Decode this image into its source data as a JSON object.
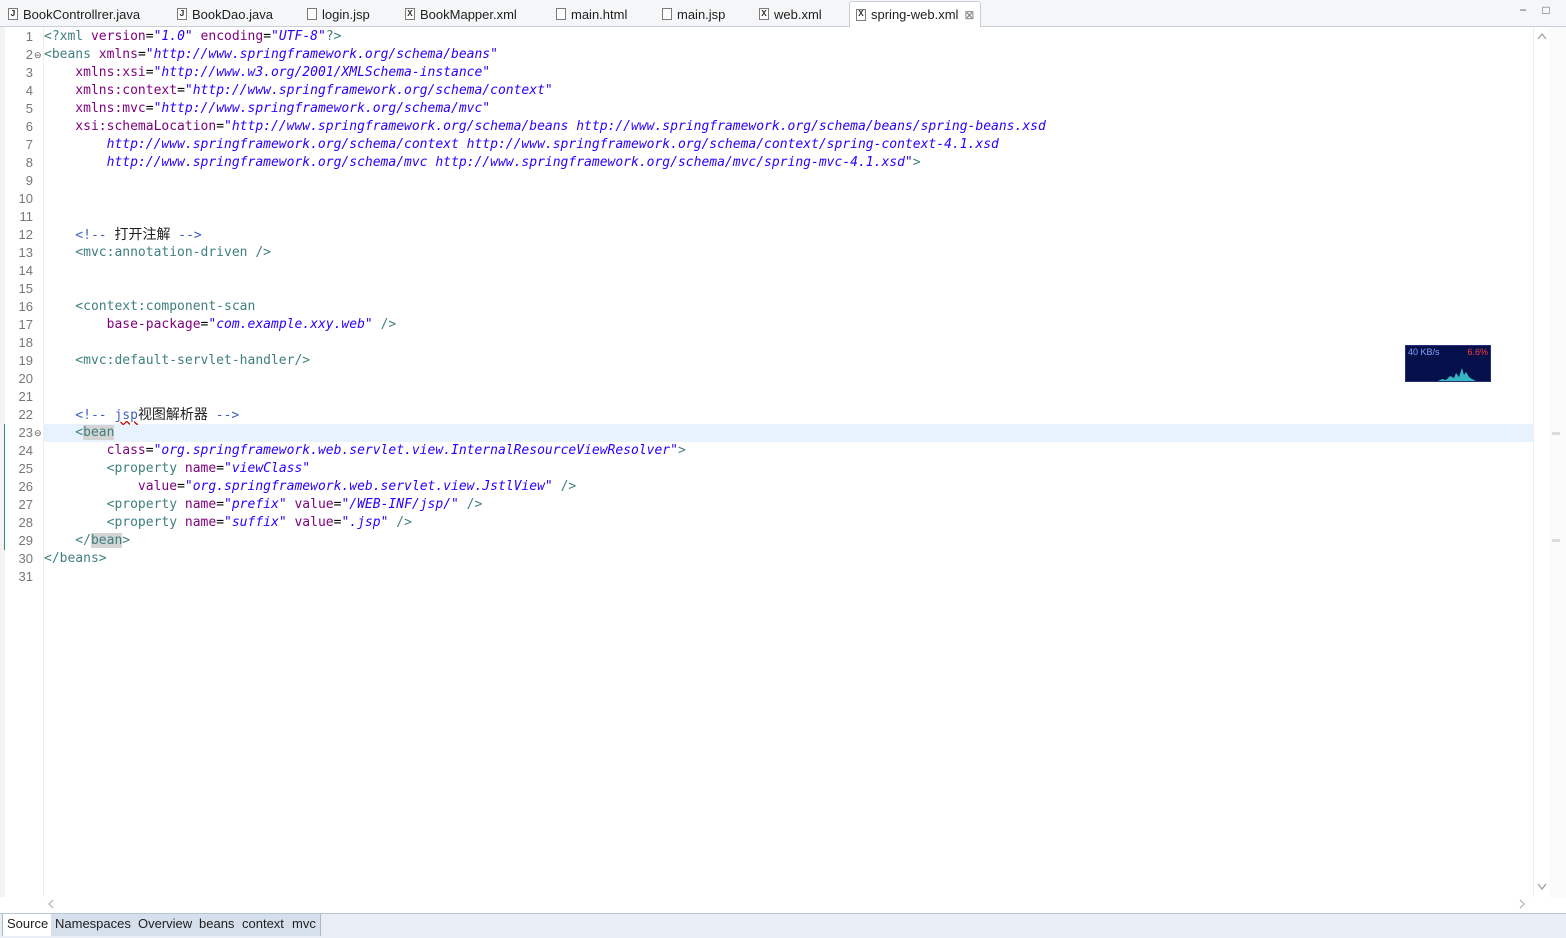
{
  "tabs": [
    {
      "label": "BookControllrer.java",
      "icon": "java-file-icon",
      "glyph": "J"
    },
    {
      "label": "BookDao.java",
      "icon": "java-file-icon",
      "glyph": "J"
    },
    {
      "label": "login.jsp",
      "icon": "jsp-file-icon",
      "glyph": ""
    },
    {
      "label": "BookMapper.xml",
      "icon": "xml-file-icon",
      "glyph": "X"
    },
    {
      "label": "main.html",
      "icon": "html-file-icon",
      "glyph": ""
    },
    {
      "label": "main.jsp",
      "icon": "jsp-file-icon",
      "glyph": ""
    },
    {
      "label": "web.xml",
      "icon": "xml-file-icon",
      "glyph": "X"
    },
    {
      "label": "spring-web.xml",
      "icon": "xml-file-icon",
      "glyph": "X",
      "active": true
    }
  ],
  "active_tab_close": "⊠",
  "window_controls": {
    "minimize": "−",
    "maximize": "□"
  },
  "line_numbers": [
    "1",
    "2",
    "3",
    "4",
    "5",
    "6",
    "7",
    "8",
    "9",
    "10",
    "11",
    "12",
    "13",
    "14",
    "15",
    "16",
    "17",
    "18",
    "19",
    "20",
    "21",
    "22",
    "23",
    "24",
    "25",
    "26",
    "27",
    "28",
    "29",
    "30",
    "31"
  ],
  "fold_marker": "⊖",
  "code": {
    "l1": {
      "a": "<?xml",
      "b": " version",
      "c": "=",
      "d": "\"1.0\"",
      "e": " encoding",
      "f": "=",
      "g": "\"UTF-8\"",
      "h": "?>"
    },
    "l2": {
      "a": "<beans",
      "b": " xmlns",
      "c": "=",
      "d": "\"http://www.springframework.org/schema/beans\""
    },
    "l3": {
      "a": "    xmlns:xsi",
      "b": "=",
      "c": "\"http://www.w3.org/2001/XMLSchema-instance\""
    },
    "l4": {
      "a": "    xmlns:context",
      "b": "=",
      "c": "\"http://www.springframework.org/schema/context\""
    },
    "l5": {
      "a": "    xmlns:mvc",
      "b": "=",
      "c": "\"http://www.springframework.org/schema/mvc\""
    },
    "l6": {
      "a": "    xsi:schemaLocation",
      "b": "=",
      "c": "\"http://www.springframework.org/schema/beans http://www.springframework.org/schema/beans/spring-beans.xsd"
    },
    "l7": {
      "a": "        http://www.springframework.org/schema/context http://www.springframework.org/schema/context/spring-context-4.1.xsd"
    },
    "l8": {
      "a": "        http://www.springframework.org/schema/mvc http://www.springframework.org/schema/mvc/spring-mvc-4.1.xsd\"",
      "b": ">"
    },
    "l12": {
      "a": "    <!-- ",
      "b": "打开注解",
      "c": " -->"
    },
    "l13": {
      "a": "    <mvc:annotation-driven />"
    },
    "l16": {
      "a": "    <context:component-scan"
    },
    "l17": {
      "a": "        base-package",
      "b": "=",
      "c": "\"com.example.xxy.web\"",
      "d": " />"
    },
    "l19": {
      "a": "    <mvc:default-servlet-handler/>"
    },
    "l22": {
      "a": "    <!-- ",
      "b": "jsp",
      "c": "视图解析器",
      "d": " -->"
    },
    "l23": {
      "a": "    <",
      "b": "bean"
    },
    "l24": {
      "a": "        class",
      "b": "=",
      "c": "\"org.springframework.web.servlet.view.InternalResourceViewResolver\"",
      "d": ">"
    },
    "l25": {
      "a": "        <property",
      "b": " name",
      "c": "=",
      "d": "\"viewClass\""
    },
    "l26": {
      "a": "            value",
      "b": "=",
      "c": "\"org.springframework.web.servlet.view.JstlView\"",
      "d": " />"
    },
    "l27": {
      "a": "        <property",
      "b": " name",
      "c": "=",
      "d": "\"prefix\"",
      "e": " value",
      "f": "=",
      "g": "\"/WEB-INF/jsp/\"",
      "h": " />"
    },
    "l28": {
      "a": "        <property",
      "b": " name",
      "c": "=",
      "d": "\"suffix\"",
      "e": " value",
      "f": "=",
      "g": "\".jsp\"",
      "h": " />"
    },
    "l29": {
      "a": "    </",
      "b": "bean",
      "c": ">"
    },
    "l30": {
      "a": "</beans>"
    }
  },
  "network_monitor": {
    "speed": "40 KB/s",
    "percent": "6.6%"
  },
  "bottom_tabs": [
    "Source",
    "Namespaces",
    "Overview",
    "beans",
    "context",
    "mvc"
  ],
  "colors": {
    "tag": "#3f7f7f",
    "attribute": "#7f007f",
    "value": "#2a00ff",
    "comment": "#3f5fbf",
    "current_line": "#e8f2fe"
  }
}
